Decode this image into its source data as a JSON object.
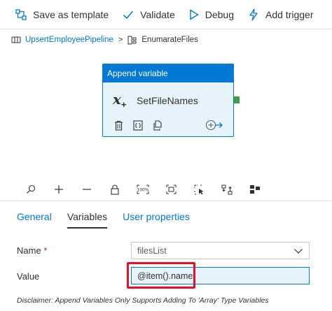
{
  "toolbar": {
    "save_template": "Save as template",
    "validate": "Validate",
    "debug": "Debug",
    "add_trigger": "Add trigger"
  },
  "breadcrumb": {
    "pipeline": "UpsertEmployeePipeline",
    "separator": ">",
    "current": "EnumarateFiles"
  },
  "activity": {
    "type": "Append variable",
    "name": "SetFileNames",
    "icon_symbol": "x",
    "plus_symbol": "+"
  },
  "tabs": [
    {
      "label": "General"
    },
    {
      "label": "Variables"
    },
    {
      "label": "User properties"
    }
  ],
  "active_tab": "Variables",
  "form": {
    "name_label": "Name",
    "required_mark": "*",
    "name_value": "filesList",
    "value_label": "Value",
    "value_value": "@item().name",
    "disclaimer": "Disclaimer: Append Variables Only Supports Adding To 'Array' Type Variables"
  },
  "colors": {
    "accent": "#0078d4",
    "highlight": "#e81123",
    "port": "#3aa048"
  }
}
